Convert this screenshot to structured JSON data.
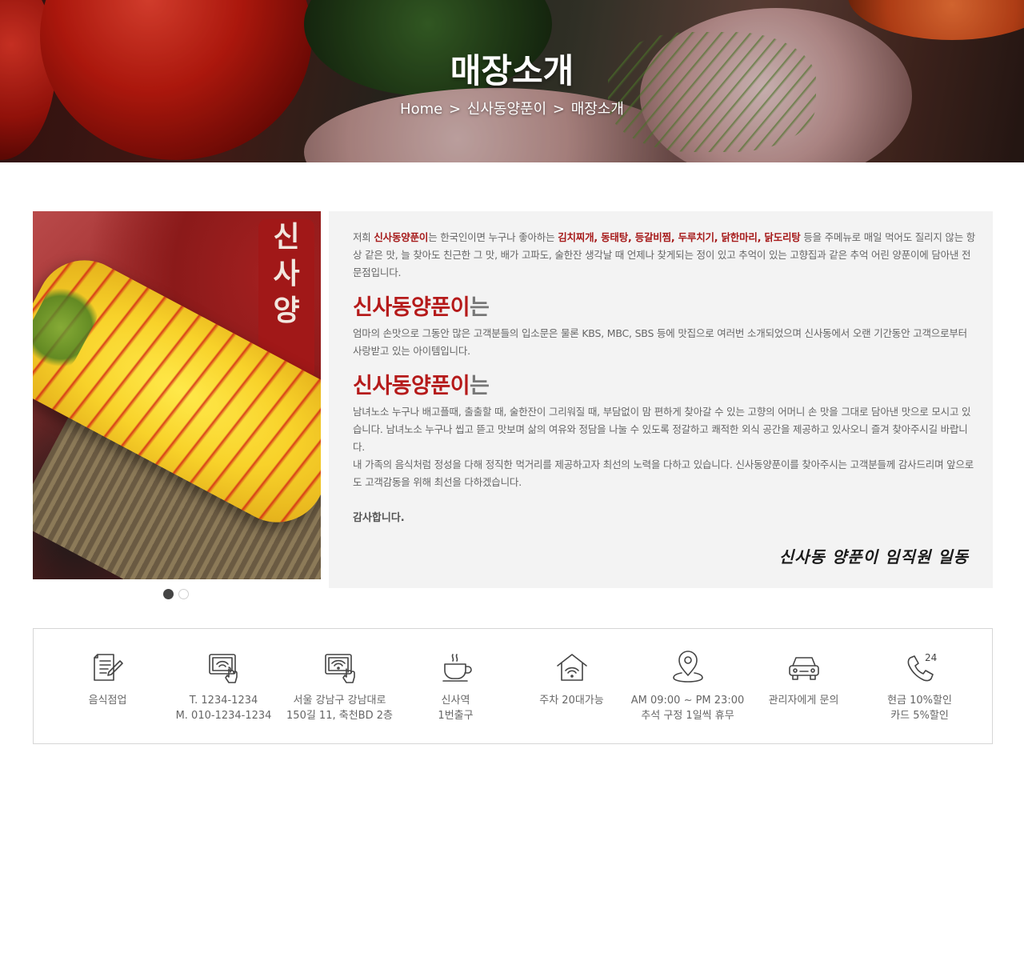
{
  "hero": {
    "title": "매장소개",
    "breadcrumb": [
      "Home",
      ">",
      "신사동양푼이",
      ">",
      "매장소개"
    ]
  },
  "slider": {
    "sign_text": [
      "신",
      "사",
      "양"
    ],
    "dots": [
      {
        "active": true
      },
      {
        "active": false
      }
    ]
  },
  "intro": {
    "p1_parts": [
      {
        "text": "저희 ",
        "hl": false
      },
      {
        "text": "신사동양푼이",
        "hl": true
      },
      {
        "text": "는 한국인이면 누구나 좋아하는 ",
        "hl": false
      },
      {
        "text": "김치찌개, 동태탕, 등갈비찜, 두루치기, 닭한마리, 닭도리탕",
        "hl": true
      },
      {
        "text": " 등을 주메뉴로 매일 먹어도 질리지 않는 항상 같은 맛, 늘 찾아도 친근한 그 맛, 배가 고파도, 술한잔 생각날 때 언제나 찾게되는 정이 있고 추억이 있는 고향집과 같은 추억 어린 양푼이에 담아낸 전문점입니다.",
        "hl": false
      }
    ],
    "heading1_brand": "신사동양푼이",
    "heading1_suffix": "는",
    "p2": "엄마의 손맛으로 그동안 많은 고객분들의 입소문은 물론 KBS, MBC, SBS 등에 맛집으로 여러번 소개되었으며 신사동에서 오랜 기간동안 고객으로부터 사랑받고 있는 아이템입니다.",
    "heading2_brand": "신사동양푼이",
    "heading2_suffix": "는",
    "p3": "남녀노소 누구나 배고플때, 출출할 때, 술한잔이 그리워질 때, 부담없이 맘 편하게 찾아갈 수 있는 고향의 어머니 손 맛을 그대로 담아낸 맛으로 모시고 있습니다. 남녀노소 누구나 씹고 뜯고 맛보며 삶의 여유와 정담을 나눌 수 있도록 정갈하고 쾌적한 외식 공간을 제공하고 있사오니 즐겨 찾아주시길 바랍니다.",
    "p4": "내 가족의 음식처럼 정성을 다해 정직한 먹거리를 제공하고자 최선의 노력을 다하고 있습니다. 신사동양푼이를 찾아주시는 고객분들께 감사드리며 앞으로도 고객감동을 위해 최선을 다하겠습니다.",
    "thanks": "감사합니다.",
    "signature": "신사동 양푼이 임직원 일동"
  },
  "info": {
    "items": [
      {
        "icon": "document-pen-icon",
        "line1": "음식점업",
        "line2": ""
      },
      {
        "icon": "tablet-touch-icon",
        "line1": "T. 1234-1234",
        "line2": "M. 010-1234-1234"
      },
      {
        "icon": "tablet-wifi-icon",
        "line1": "서울 강남구 강남대로",
        "line2": "150길 11, 축천BD 2층"
      },
      {
        "icon": "coffee-cup-icon",
        "line1": "신사역",
        "line2": "1번출구"
      },
      {
        "icon": "house-wifi-icon",
        "line1": "주차 20대가능",
        "line2": ""
      },
      {
        "icon": "location-pin-icon",
        "line1": "AM 09:00 ~ PM 23:00",
        "line2": "추석 구정 1일씩 휴무"
      },
      {
        "icon": "car-icon",
        "line1": "관리자에게 문의",
        "line2": ""
      },
      {
        "icon": "phone-24-icon",
        "line1": "현금 10%할인",
        "line2": "카드 5%할인",
        "badge": "24"
      }
    ]
  },
  "colors": {
    "accent": "#b51a1a",
    "panel_bg": "#f3f3f3",
    "text": "#666666"
  }
}
